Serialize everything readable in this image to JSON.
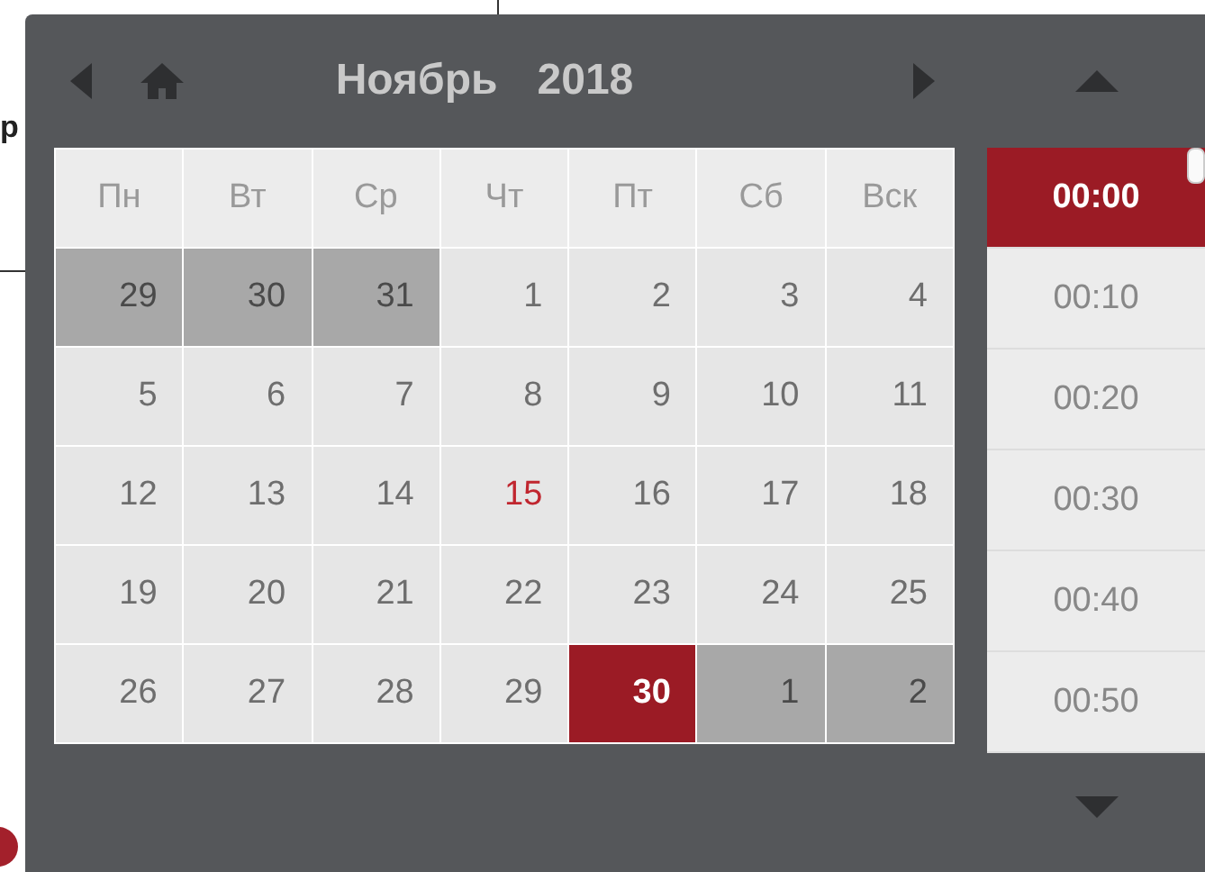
{
  "page_behind": {
    "label_fragment": "р"
  },
  "picker": {
    "month": "Ноябрь",
    "year": "2018",
    "weekdays": [
      "Пн",
      "Вт",
      "Ср",
      "Чт",
      "Пт",
      "Сб",
      "Вск"
    ],
    "weeks": [
      [
        {
          "day": "29",
          "other_month": true,
          "today": false,
          "selected": false
        },
        {
          "day": "30",
          "other_month": true,
          "today": false,
          "selected": false
        },
        {
          "day": "31",
          "other_month": true,
          "today": false,
          "selected": false
        },
        {
          "day": "1",
          "other_month": false,
          "today": false,
          "selected": false
        },
        {
          "day": "2",
          "other_month": false,
          "today": false,
          "selected": false
        },
        {
          "day": "3",
          "other_month": false,
          "today": false,
          "selected": false
        },
        {
          "day": "4",
          "other_month": false,
          "today": false,
          "selected": false
        }
      ],
      [
        {
          "day": "5",
          "other_month": false,
          "today": false,
          "selected": false
        },
        {
          "day": "6",
          "other_month": false,
          "today": false,
          "selected": false
        },
        {
          "day": "7",
          "other_month": false,
          "today": false,
          "selected": false
        },
        {
          "day": "8",
          "other_month": false,
          "today": false,
          "selected": false
        },
        {
          "day": "9",
          "other_month": false,
          "today": false,
          "selected": false
        },
        {
          "day": "10",
          "other_month": false,
          "today": false,
          "selected": false
        },
        {
          "day": "11",
          "other_month": false,
          "today": false,
          "selected": false
        }
      ],
      [
        {
          "day": "12",
          "other_month": false,
          "today": false,
          "selected": false
        },
        {
          "day": "13",
          "other_month": false,
          "today": false,
          "selected": false
        },
        {
          "day": "14",
          "other_month": false,
          "today": false,
          "selected": false
        },
        {
          "day": "15",
          "other_month": false,
          "today": true,
          "selected": false
        },
        {
          "day": "16",
          "other_month": false,
          "today": false,
          "selected": false
        },
        {
          "day": "17",
          "other_month": false,
          "today": false,
          "selected": false
        },
        {
          "day": "18",
          "other_month": false,
          "today": false,
          "selected": false
        }
      ],
      [
        {
          "day": "19",
          "other_month": false,
          "today": false,
          "selected": false
        },
        {
          "day": "20",
          "other_month": false,
          "today": false,
          "selected": false
        },
        {
          "day": "21",
          "other_month": false,
          "today": false,
          "selected": false
        },
        {
          "day": "22",
          "other_month": false,
          "today": false,
          "selected": false
        },
        {
          "day": "23",
          "other_month": false,
          "today": false,
          "selected": false
        },
        {
          "day": "24",
          "other_month": false,
          "today": false,
          "selected": false
        },
        {
          "day": "25",
          "other_month": false,
          "today": false,
          "selected": false
        }
      ],
      [
        {
          "day": "26",
          "other_month": false,
          "today": false,
          "selected": false
        },
        {
          "day": "27",
          "other_month": false,
          "today": false,
          "selected": false
        },
        {
          "day": "28",
          "other_month": false,
          "today": false,
          "selected": false
        },
        {
          "day": "29",
          "other_month": false,
          "today": false,
          "selected": false
        },
        {
          "day": "30",
          "other_month": false,
          "today": false,
          "selected": true
        },
        {
          "day": "1",
          "other_month": true,
          "today": false,
          "selected": false
        },
        {
          "day": "2",
          "other_month": true,
          "today": false,
          "selected": false
        }
      ]
    ],
    "times": [
      {
        "label": "00:00",
        "selected": true
      },
      {
        "label": "00:10",
        "selected": false
      },
      {
        "label": "00:20",
        "selected": false
      },
      {
        "label": "00:30",
        "selected": false
      },
      {
        "label": "00:40",
        "selected": false
      },
      {
        "label": "00:50",
        "selected": false
      }
    ]
  }
}
